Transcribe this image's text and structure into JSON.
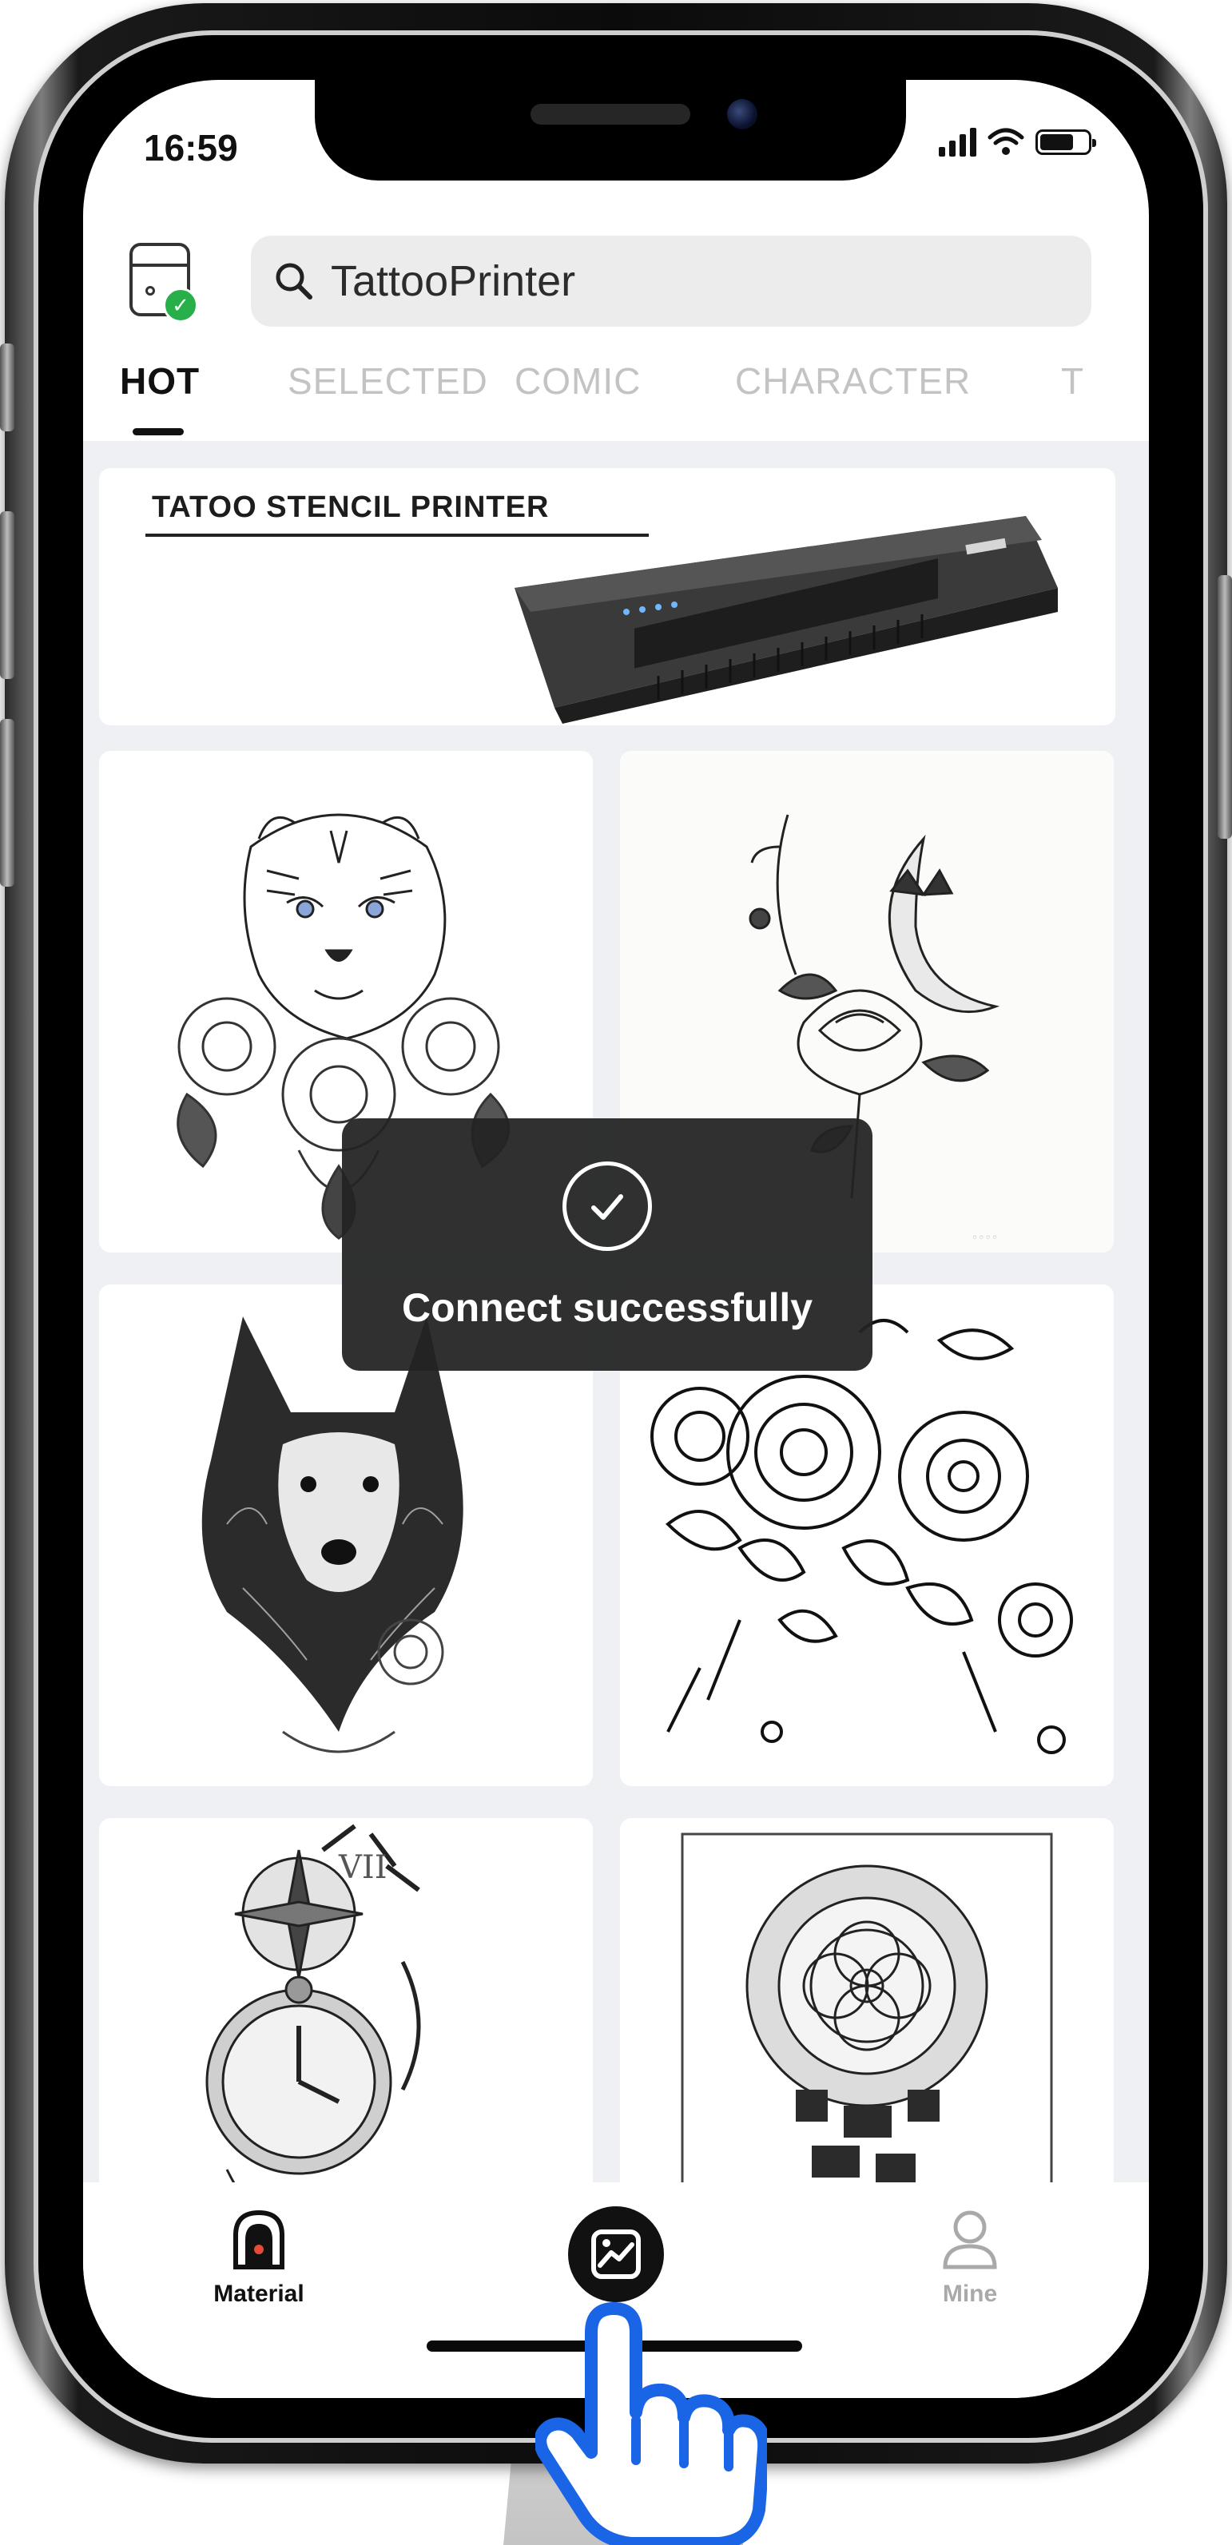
{
  "status_bar": {
    "time": "16:59"
  },
  "header": {
    "search_text": "TattooPrinter"
  },
  "tabs": [
    {
      "label": "HOT",
      "active": true
    },
    {
      "label": "SELECTED",
      "active": false
    },
    {
      "label": "COMIC",
      "active": false
    },
    {
      "label": "CHARACTER",
      "active": false
    },
    {
      "label": "T",
      "active": false
    }
  ],
  "banner": {
    "title": "TATOO STENCIL PRINTER"
  },
  "toast": {
    "message": "Connect successfully"
  },
  "tabbar": {
    "items": [
      {
        "label": "Material",
        "icon": "material-icon",
        "color": "#111111"
      },
      {
        "label": "",
        "icon": "create-image-icon",
        "color": "#111111"
      },
      {
        "label": "Mine",
        "icon": "person-icon",
        "color": "#a9a9a9"
      }
    ]
  },
  "colors": {
    "accent": "#1a64e6",
    "success": "#27b04a",
    "toast_bg": "#232323"
  }
}
